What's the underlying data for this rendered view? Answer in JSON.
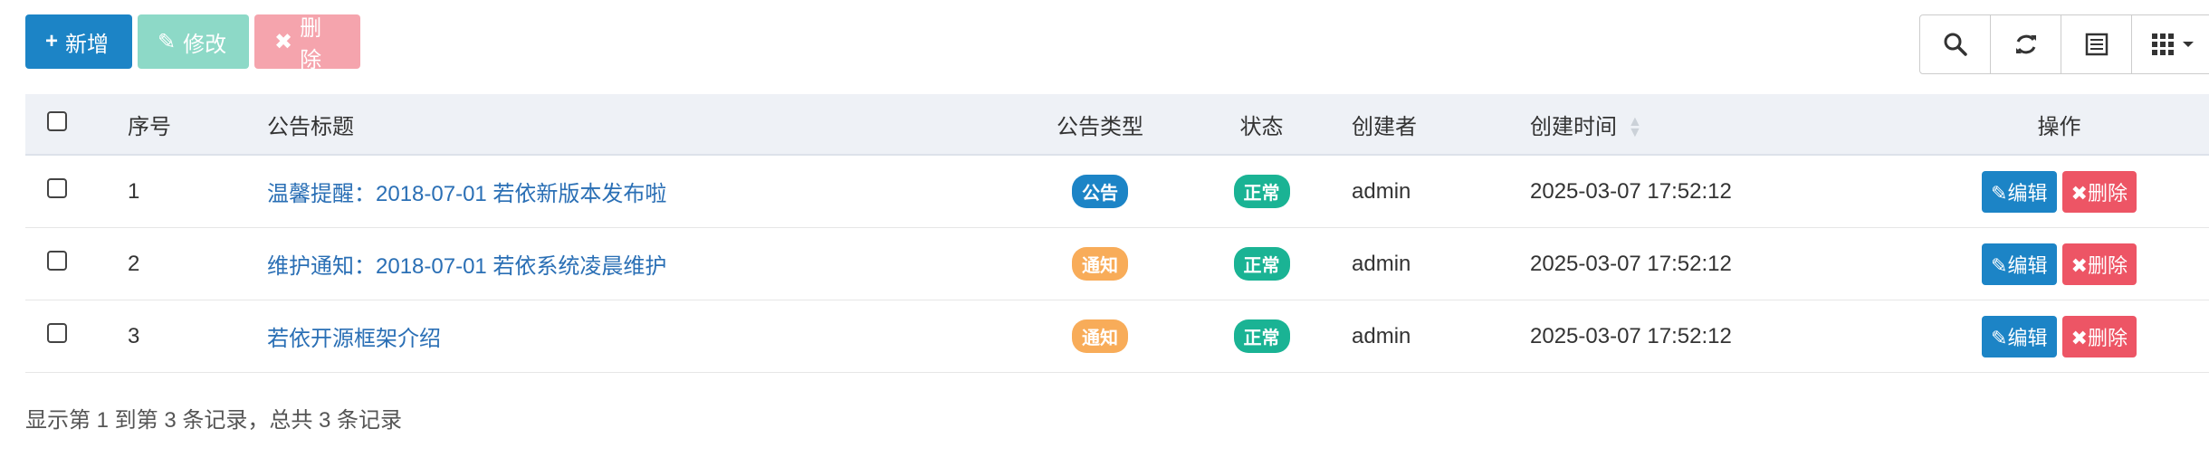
{
  "toolbar": {
    "add": {
      "icon": "+",
      "label": "新增"
    },
    "edit": {
      "icon": "✎",
      "label": "修改"
    },
    "delete": {
      "icon": "✖",
      "label": "删除"
    }
  },
  "colors": {
    "primary": "#1c84c6",
    "success": "#1ab394",
    "warning": "#f8ac59",
    "danger": "#ed5565"
  },
  "table": {
    "headers": {
      "no": "序号",
      "title": "公告标题",
      "type": "公告类型",
      "status": "状态",
      "creator": "创建者",
      "time": "创建时间",
      "ops": "操作"
    },
    "rows": [
      {
        "no": "1",
        "title": "温馨提醒：2018-07-01 若依新版本发布啦",
        "type": "公告",
        "status": "正常",
        "creator": "admin",
        "time": "2025-03-07 17:52:12",
        "edit": "编辑",
        "delete": "删除"
      },
      {
        "no": "2",
        "title": "维护通知：2018-07-01 若依系统凌晨维护",
        "type": "通知",
        "status": "正常",
        "creator": "admin",
        "time": "2025-03-07 17:52:12",
        "edit": "编辑",
        "delete": "删除"
      },
      {
        "no": "3",
        "title": "若依开源框架介绍",
        "type": "通知",
        "status": "正常",
        "creator": "admin",
        "time": "2025-03-07 17:52:12",
        "edit": "编辑",
        "delete": "删除"
      }
    ]
  },
  "footer": "显示第 1 到第 3 条记录，总共 3 条记录"
}
